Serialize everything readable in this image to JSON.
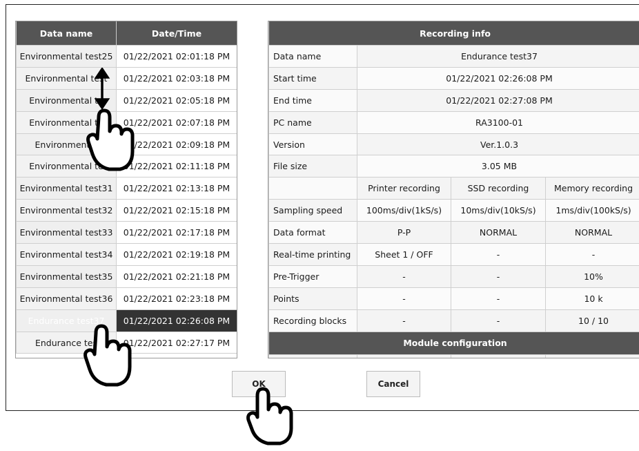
{
  "list": {
    "headers": [
      "Data name",
      "Date/Time"
    ],
    "rows": [
      {
        "name": "Environmental test25",
        "time": "01/22/2021 02:01:18 PM"
      },
      {
        "name": "Environmental test",
        "time": "01/22/2021 02:03:18 PM"
      },
      {
        "name": "Environmental te",
        "time": "01/22/2021 02:05:18 PM"
      },
      {
        "name": "Environmental te",
        "time": "01/22/2021 02:07:18 PM"
      },
      {
        "name": "Environmental",
        "time": "01/22/2021 02:09:18 PM"
      },
      {
        "name": "Environmental te",
        "time": "01/22/2021 02:11:18 PM"
      },
      {
        "name": "Environmental test31",
        "time": "01/22/2021 02:13:18 PM"
      },
      {
        "name": "Environmental test32",
        "time": "01/22/2021 02:15:18 PM"
      },
      {
        "name": "Environmental test33",
        "time": "01/22/2021 02:17:18 PM"
      },
      {
        "name": "Environmental test34",
        "time": "01/22/2021 02:19:18 PM"
      },
      {
        "name": "Environmental test35",
        "time": "01/22/2021 02:21:18 PM"
      },
      {
        "name": "Environmental test36",
        "time": "01/22/2021 02:23:18 PM"
      },
      {
        "name": "Endurance test37",
        "time": "01/22/2021 02:26:08 PM",
        "selected": true
      },
      {
        "name": "Endurance tes",
        "time": "01/22/2021 02:27:17 PM"
      }
    ]
  },
  "info": {
    "title": "Recording info",
    "rows": [
      {
        "label": "Data name",
        "value": "Endurance test37"
      },
      {
        "label": "Start time",
        "value": "01/22/2021 02:26:08 PM"
      },
      {
        "label": "End time",
        "value": "01/22/2021 02:27:08 PM"
      },
      {
        "label": "PC name",
        "value": "RA3100-01"
      },
      {
        "label": "Version",
        "value": "Ver.1.0.3"
      },
      {
        "label": "File size",
        "value": "3.05 MB"
      }
    ],
    "columns": [
      "Printer recording",
      "SSD recording",
      "Memory recording"
    ],
    "grid": [
      {
        "label": "Sampling speed",
        "values": [
          "100ms/div(1kS/s)",
          "10ms/div(10kS/s)",
          "1ms/div(100kS/s)"
        ]
      },
      {
        "label": "Data format",
        "values": [
          "P-P",
          "NORMAL",
          "NORMAL"
        ]
      },
      {
        "label": "Real-time printing",
        "values": [
          "Sheet 1 / OFF",
          "-",
          "-"
        ]
      },
      {
        "label": "Pre-Trigger",
        "values": [
          "-",
          "-",
          "10%"
        ]
      },
      {
        "label": "Points",
        "values": [
          "-",
          "-",
          "10 k"
        ]
      },
      {
        "label": "Recording blocks",
        "values": [
          "-",
          "-",
          "10 / 10"
        ]
      }
    ],
    "module_title": "Module configuration"
  },
  "buttons": {
    "ok": "OK",
    "cancel": "Cancel"
  },
  "colors": {
    "header": "#555555",
    "selected": "#333333"
  }
}
